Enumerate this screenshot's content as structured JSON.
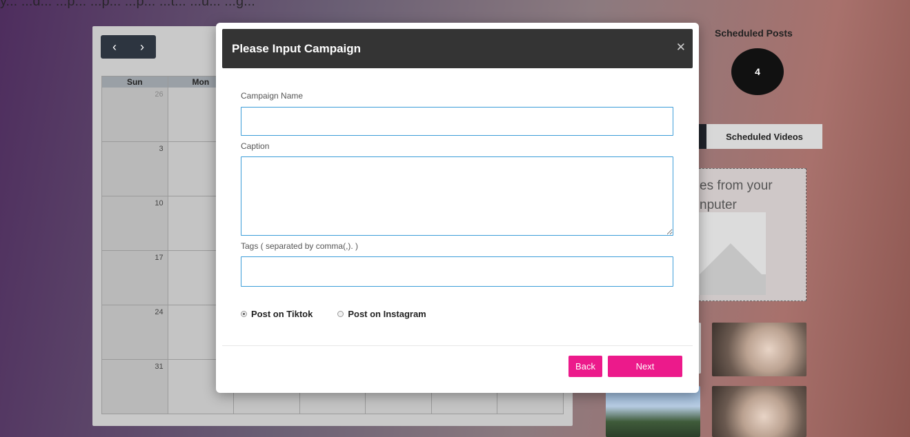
{
  "background": {
    "top_text": "y... ...d... ...p... ...p... ...p... ...t... ...u... ...g...",
    "calendar": {
      "prev_icon": "chevron-left-icon",
      "next_icon": "chevron-right-icon",
      "day_headers": [
        "Sun",
        "Mon",
        "",
        "",
        "",
        "",
        ""
      ],
      "rows": [
        [
          "26",
          "",
          "",
          "",
          "",
          "",
          ""
        ],
        [
          "3",
          "",
          "",
          "",
          "",
          "",
          ""
        ],
        [
          "10",
          "",
          "",
          "",
          "",
          "",
          ""
        ],
        [
          "17",
          "",
          "",
          "",
          "",
          "",
          ""
        ],
        [
          "24",
          "",
          "",
          "",
          "",
          "",
          ""
        ],
        [
          "31",
          "",
          "",
          "",
          "",
          "",
          ""
        ]
      ]
    },
    "sidebar": {
      "scheduled_title": "Scheduled Posts",
      "scheduled_count": "4",
      "tab_videos": "Scheduled Videos",
      "upload_line1": "es from your",
      "upload_line2": "nputer"
    }
  },
  "modal": {
    "title": "Please Input Campaign",
    "close_icon": "close-icon",
    "campaign_name_label": "Campaign Name",
    "campaign_name_value": "",
    "caption_label": "Caption",
    "caption_value": "",
    "tags_label": "Tags ( separated by comma(,). )",
    "tags_value": "",
    "radio_tiktok": "Post on Tiktok",
    "radio_instagram": "Post on Instagram",
    "selected_platform": "tiktok",
    "back_label": "Back",
    "next_label": "Next"
  },
  "colors": {
    "accent": "#ec1a8b",
    "header_bg": "#343434",
    "input_border": "#3a9cd8"
  }
}
